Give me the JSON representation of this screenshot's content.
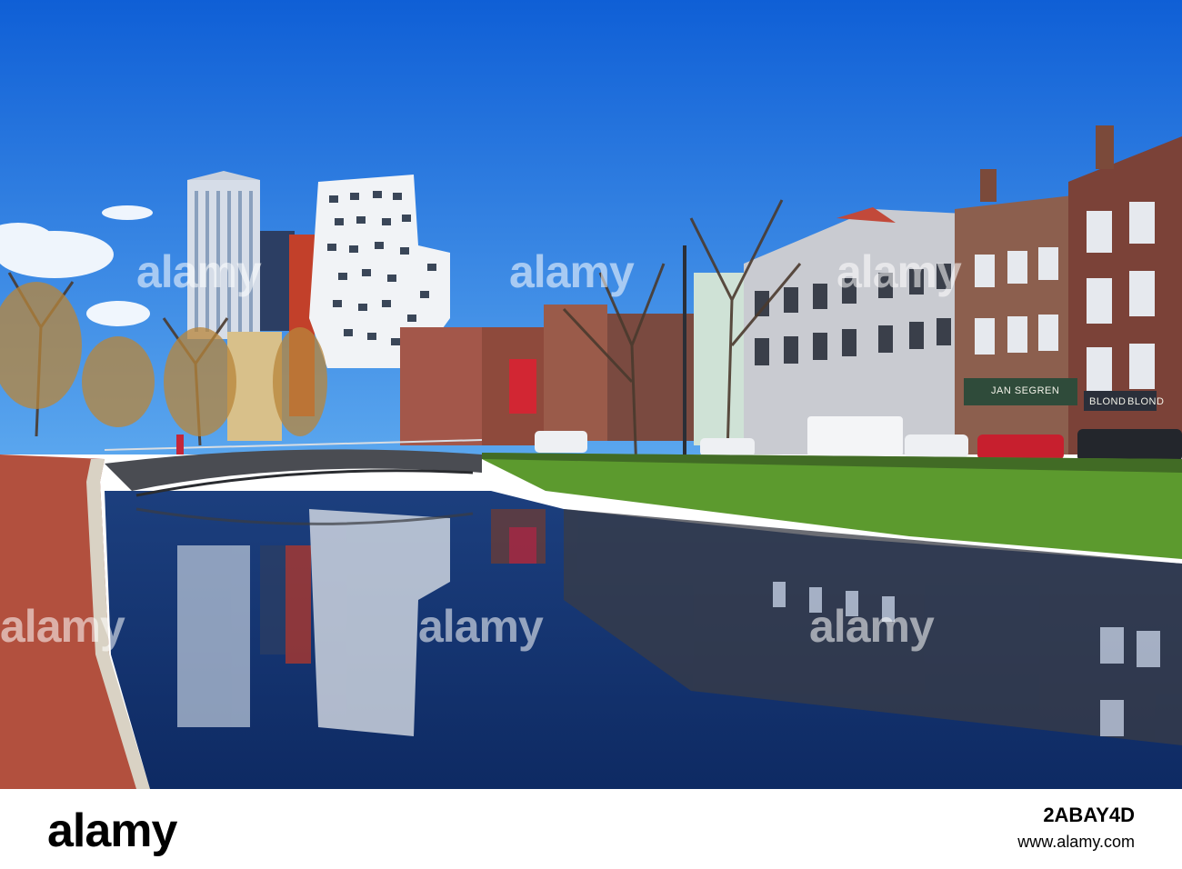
{
  "scene": {
    "sky_color": "#1b6ed8",
    "water_color": "#17305e",
    "grass_color": "#5c9a2e",
    "sidewalk_color": "#b2503e"
  },
  "signs": {
    "shop_sign_1": "JAN SEGREN",
    "shop_sign_2": "BLOND",
    "shop_sign_3": "BLOND"
  },
  "watermark": {
    "text": "alamy"
  },
  "footer": {
    "logo": "alamy",
    "image_id": "2ABAY4D",
    "url": "www.alamy.com"
  }
}
